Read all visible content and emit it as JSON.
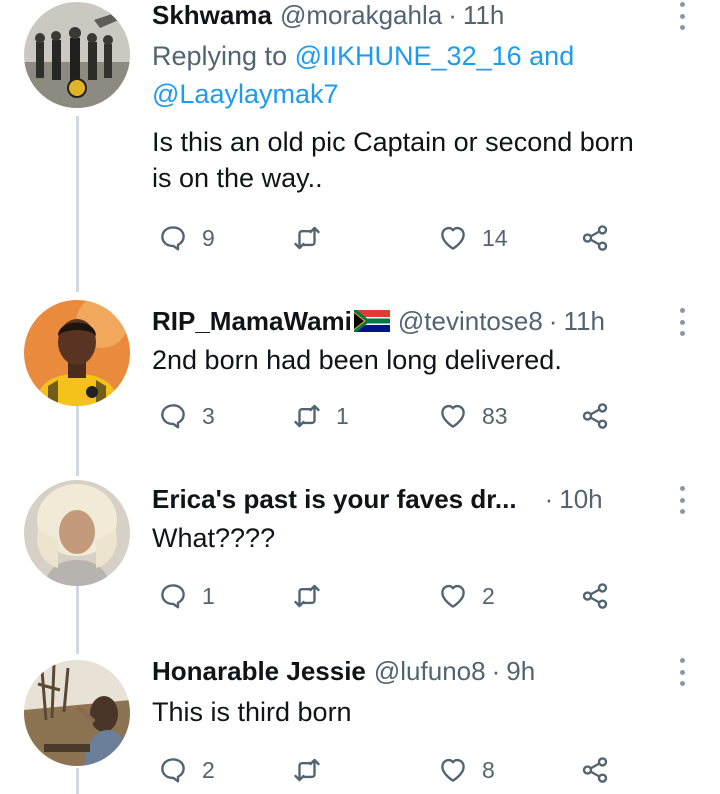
{
  "tweets": [
    {
      "name": "Skhwama",
      "handle": "@morakgahla",
      "separator": "·",
      "time": "11h",
      "replying_prefix": "Replying to",
      "replying_mention1": "@IIKHUNE_32_16",
      "replying_and": "and",
      "replying_mention2": "@Laaylaymak7",
      "text_line1": "Is this an old pic Captain or second born",
      "text_line2": "is on the way..",
      "replies": "9",
      "retweets": "",
      "likes": "14"
    },
    {
      "name": "RIP_MamaWami",
      "handle": "@tevintose8",
      "separator": "·",
      "time": "11h",
      "flag": "south-africa-flag",
      "text_line1": "2nd born had been long delivered.",
      "replies": "3",
      "retweets": "1",
      "likes": "83"
    },
    {
      "name": "Erica's past is your faves dr...",
      "handle": "",
      "separator": "·",
      "time": "10h",
      "text_line1": "What????",
      "replies": "1",
      "retweets": "",
      "likes": "2"
    },
    {
      "name": "Honarable Jessie",
      "handle": "@lufuno8",
      "separator": "·",
      "time": "9h",
      "text_line1": "This is third born",
      "replies": "2",
      "retweets": "",
      "likes": "8"
    }
  ],
  "icons": {
    "reply": "reply-icon",
    "retweet": "retweet-icon",
    "like": "heart-icon",
    "share": "share-icon",
    "more": "more-options-icon"
  },
  "colors": {
    "text": "#0f1419",
    "secondary": "#536471",
    "link": "#1d9bf0",
    "thread_line": "#cfd9de"
  }
}
